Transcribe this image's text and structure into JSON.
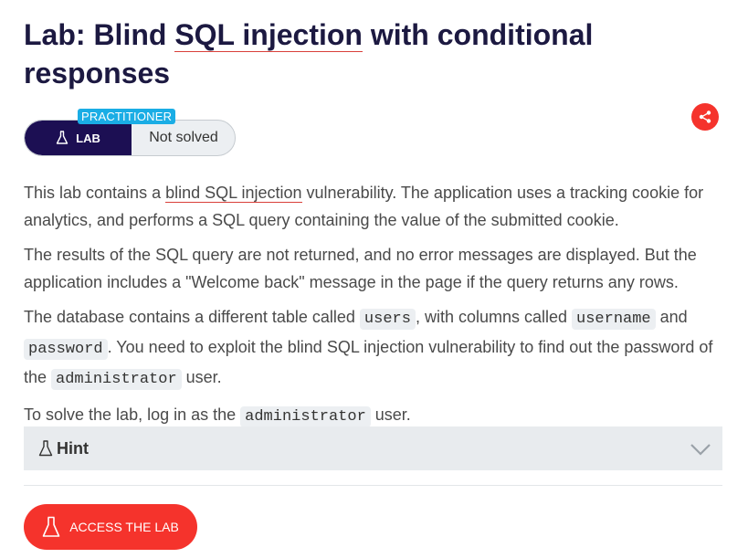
{
  "header": {
    "title_prefix": "Lab: Blind ",
    "title_link": "SQL injection",
    "title_suffix": " with conditional responses"
  },
  "badge": {
    "level": "PRACTITIONER",
    "lab_label": "LAB",
    "status": "Not solved"
  },
  "share": {
    "icon": "share-icon"
  },
  "description": {
    "p1_before": "This lab contains a ",
    "p1_link": "blind SQL injection",
    "p1_after": " vulnerability. The application uses a tracking cookie for analytics, and performs a SQL query containing the value of the submitted cookie.",
    "p2": "The results of the SQL query are not returned, and no error messages are displayed. But the application includes a \"Welcome back\" message in the page if the query returns any rows.",
    "p3_a": "The database contains a different table called ",
    "p3_code1": "users",
    "p3_b": ", with columns called ",
    "p3_code2": "username",
    "p3_c": " and ",
    "p3_code3": "password",
    "p3_d": ". You need to exploit the blind SQL injection vulnerability to find out the password of the ",
    "p3_code4": "administrator",
    "p3_e": " user.",
    "p4_a": "To solve the lab, log in as the ",
    "p4_code": "administrator",
    "p4_b": " user."
  },
  "hint": {
    "label": "Hint",
    "icon": "flask-icon",
    "chevron": "chevron-down-icon"
  },
  "access_button": {
    "label": "ACCESS THE LAB",
    "icon": "flask-icon"
  },
  "colors": {
    "title": "#1c1941",
    "accent": "#f5332c",
    "lab_badge": "#1c0f53",
    "level_badge": "#1aade5",
    "hint_bg": "#e8ebee"
  }
}
